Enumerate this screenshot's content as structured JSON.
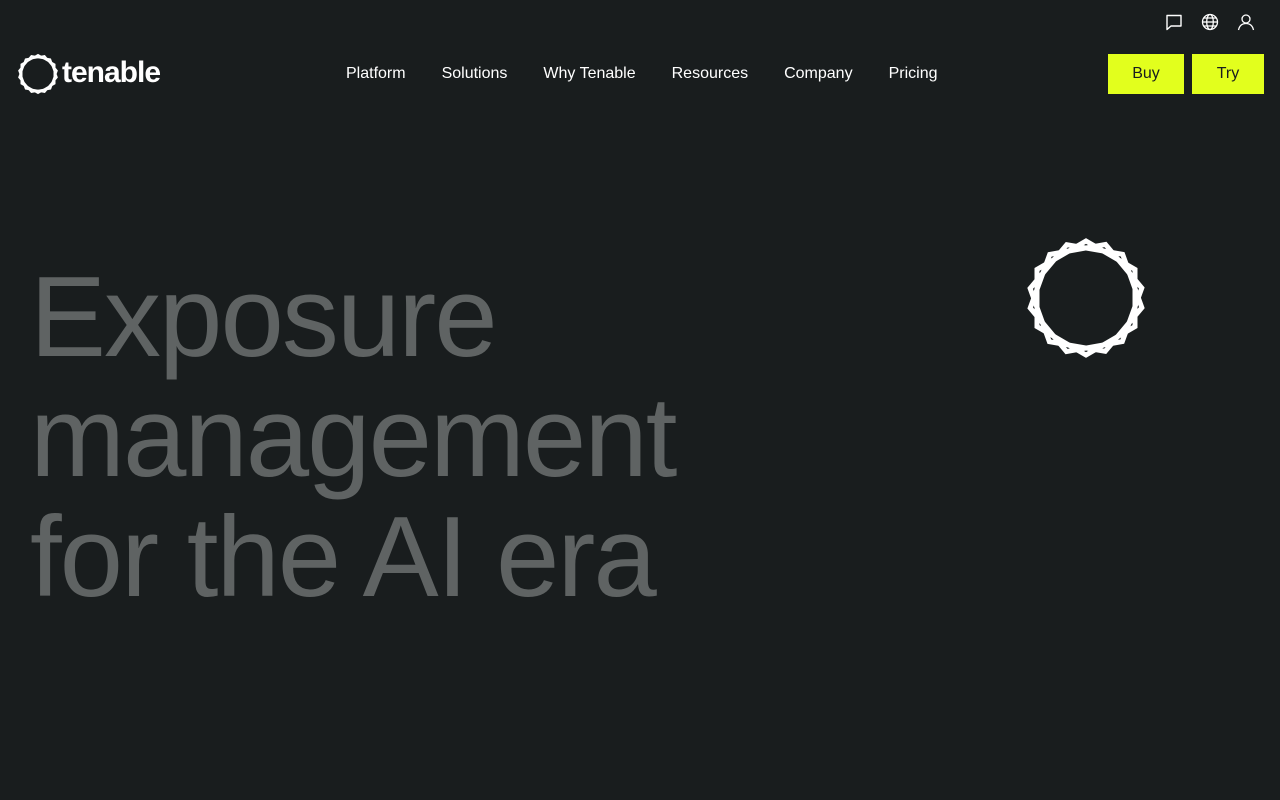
{
  "brand": {
    "name": "tenable",
    "logo_icon": "tenable-hexagon-logo"
  },
  "utility": {
    "icons": [
      "chat-icon",
      "globe-icon",
      "user-icon"
    ]
  },
  "nav": {
    "items": [
      {
        "label": "Platform"
      },
      {
        "label": "Solutions"
      },
      {
        "label": "Why Tenable"
      },
      {
        "label": "Resources"
      },
      {
        "label": "Company"
      },
      {
        "label": "Pricing"
      }
    ]
  },
  "cta": {
    "buy_label": "Buy",
    "try_label": "Try"
  },
  "hero": {
    "lines": [
      "Exposure",
      "management",
      "for the AI era"
    ]
  },
  "colors": {
    "background": "#191d1e",
    "accent": "#e2ff1d",
    "hero_text": "#5f6363",
    "nav_text": "#ffffff"
  }
}
